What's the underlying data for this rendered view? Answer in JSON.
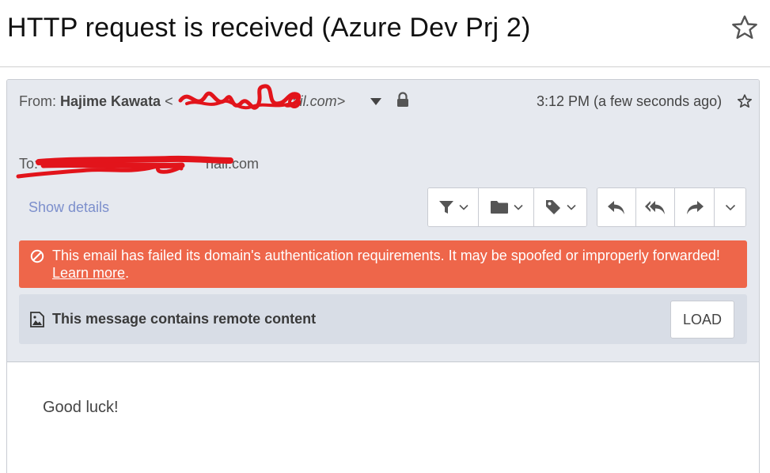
{
  "subject": "HTTP request is received (Azure Dev Prj 2)",
  "header": {
    "from_label": "From:",
    "sender_name": "Hajime Kawata",
    "sender_address_visible": "ail.com>",
    "time": "3:12 PM (a few seconds ago)",
    "to_label": "To:",
    "to_address_visible": "nail.com",
    "show_details": "Show details"
  },
  "toolbar": {
    "filter_icon": "filter-icon",
    "folder_icon": "folder-icon",
    "tag_icon": "tag-icon",
    "reply_icon": "reply-icon",
    "reply_all_icon": "reply-all-icon",
    "forward_icon": "forward-icon",
    "more_icon": "chevron-down-icon"
  },
  "warning": {
    "text": "This email has failed its domain's authentication requirements. It may be spoofed or improperly forwarded!",
    "link": "Learn more",
    "suffix": ".",
    "color": "#ee664a"
  },
  "remote_content": {
    "text": "This message contains remote content",
    "load_label": "LOAD"
  },
  "body": {
    "text": "Good luck!"
  },
  "colors": {
    "header_bg": "#e6e9ef",
    "link": "#7c8fcc",
    "redaction": "#e2141b"
  }
}
